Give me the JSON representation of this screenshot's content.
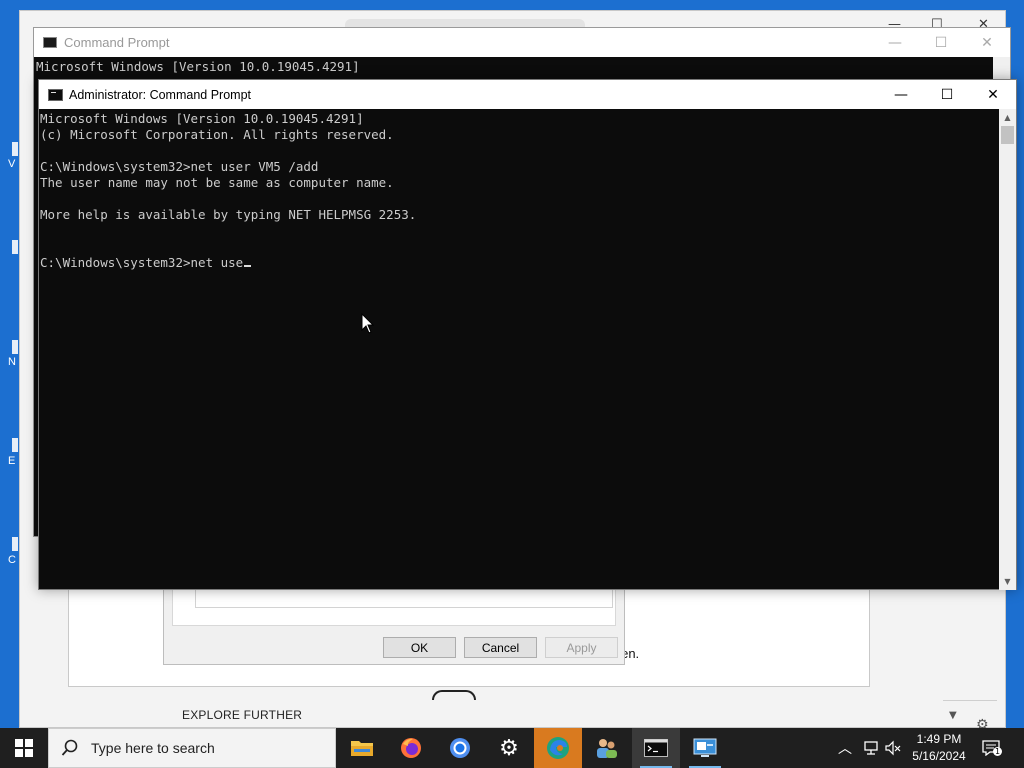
{
  "desktop": {
    "icon_label_fragments": [
      "V",
      "N",
      "E",
      "C"
    ]
  },
  "browser": {
    "controls": [
      "—",
      "☐",
      "✕"
    ],
    "settings_text": "ay email address on the sign-in screen.",
    "explore_label": "EXPLORE FURTHER"
  },
  "dialog": {
    "ok_label": "OK",
    "cancel_label": "Cancel",
    "apply_label": "Apply"
  },
  "cmd_back": {
    "title": "Command Prompt",
    "line1": "Microsoft Windows [Version 10.0.19045.4291]",
    "controls": {
      "minimize": "—",
      "maximize": "☐",
      "close": "✕"
    }
  },
  "cmd_front": {
    "title": "Administrator: Command Prompt",
    "controls": {
      "minimize": "—",
      "maximize": "☐",
      "close": "✕"
    },
    "lines": [
      "Microsoft Windows [Version 10.0.19045.4291]",
      "(c) Microsoft Corporation. All rights reserved.",
      "",
      "C:\\Windows\\system32>net user VM5 /add",
      "The user name may not be same as computer name.",
      "",
      "More help is available by typing NET HELPMSG 2253.",
      "",
      "",
      "C:\\Windows\\system32>net use"
    ]
  },
  "taskbar": {
    "search_placeholder": "Type here to search",
    "apps": [
      "file-explorer",
      "firefox",
      "chrome",
      "settings",
      "edge",
      "users",
      "command-prompt",
      "remote-desktop"
    ],
    "tray": {
      "chevron": "^",
      "time": "1:49 PM",
      "date": "5/16/2024"
    }
  },
  "colors": {
    "desktop": "#1c6fd0",
    "console_bg": "#0c0c0c",
    "console_text": "#cccccc",
    "taskbar": "#1f1f1f",
    "edge_active": "#d97a1f"
  }
}
